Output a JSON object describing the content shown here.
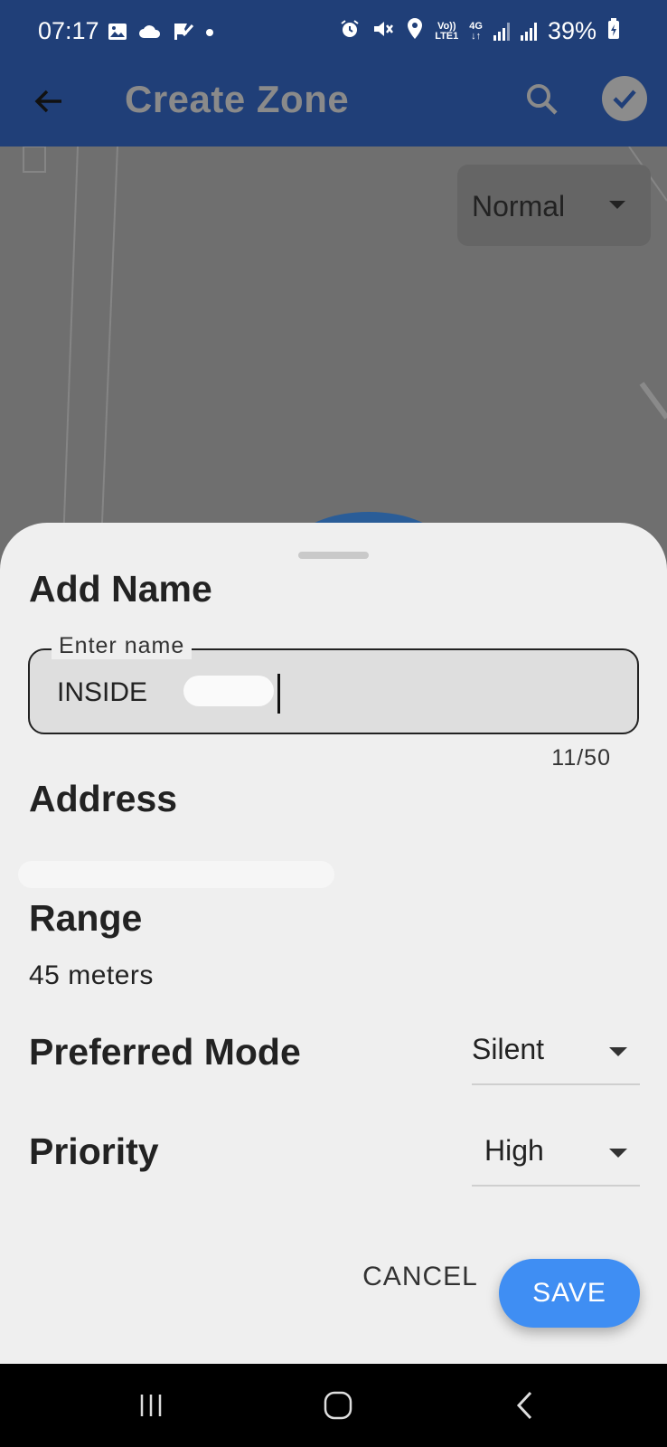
{
  "status_bar": {
    "time": "07:17",
    "battery": "39%",
    "network_top": "Vo))",
    "network_bottom": "LTE1",
    "network_type": "4G",
    "left_icons": [
      "gallery-icon",
      "cloud-icon",
      "check-flag-icon",
      "dot-icon"
    ],
    "right_icons": [
      "alarm-icon",
      "mute-icon",
      "location-icon",
      "signal-icon",
      "signal-icon",
      "battery-icon"
    ]
  },
  "app_bar": {
    "title": "Create Zone",
    "background": "#203f78"
  },
  "map": {
    "map_type": "Normal"
  },
  "sheet": {
    "add_name_heading": "Add Name",
    "name_field": {
      "label": "Enter name",
      "value": "INSIDE",
      "counter": "11/50"
    },
    "address_heading": "Address",
    "range_heading": "Range",
    "range_value": "45 meters",
    "preferred_mode_heading": "Preferred Mode",
    "preferred_mode_value": "Silent",
    "priority_heading": "Priority",
    "priority_value": "High",
    "cancel_label": "CANCEL",
    "save_label": "SAVE",
    "accent": "#3f8ef3"
  }
}
